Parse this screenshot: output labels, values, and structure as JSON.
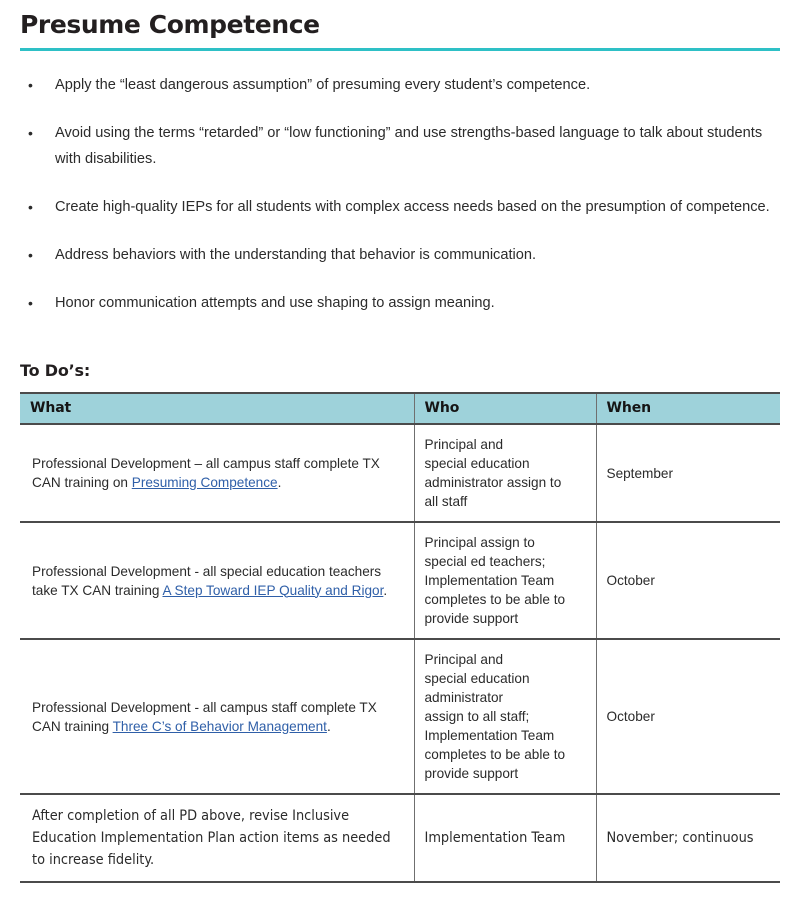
{
  "document": {
    "title": "Presume Competence",
    "accent_rule_color": "#2ec0c6",
    "table_header_color": "#9ed2da",
    "link_color": "#2f5fa8"
  },
  "bullets": [
    {
      "marker": "•",
      "text": "Apply the “least dangerous assumption” of presuming every student’s competence."
    },
    {
      "marker": "•",
      "text": "Avoid using the terms “retarded” or “low functioning” and use strengths-based language to talk about students with disabilities."
    },
    {
      "marker": "•",
      "text": "Create high-quality IEPs for all students with complex access needs based on the presumption of competence."
    },
    {
      "marker": "•",
      "text": "Address behaviors with the understanding that behavior is communication."
    },
    {
      "marker": "•",
      "text": "Honor communication attempts and use shaping to assign meaning."
    }
  ],
  "todo": {
    "heading": "To Do’s:",
    "columns": [
      "What",
      "Who",
      "When"
    ],
    "rows": [
      {
        "what_prefix": "Professional Development – all campus staff complete TX CAN training on ",
        "what_link": "Presuming Competence",
        "what_suffix": ".",
        "who_lines": [
          "Principal and",
          "special education",
          "administrator assign to",
          "all staff"
        ],
        "when": "September"
      },
      {
        "what_prefix": "Professional Development - all special education teachers take TX CAN training ",
        "what_link": "A Step Toward IEP Quality and Rigor",
        "what_suffix": ".",
        "who_lines": [
          "Principal assign to",
          "special ed teachers;",
          "Implementation Team",
          "completes to be able to",
          "provide support"
        ],
        "when": "October"
      },
      {
        "what_prefix": "Professional Development - all campus staff complete TX CAN training ",
        "what_link": "Three C’s of Behavior Management",
        "what_suffix": ".",
        "who_lines": [
          "Principal and",
          "special education",
          "administrator",
          "assign to all staff;",
          "Implementation Team",
          "completes to be able to",
          "provide support"
        ],
        "when": "October"
      },
      {
        "what_prefix": "After completion of all PD above, revise Inclusive Education Implementation Plan action items as needed to increase fidelity.",
        "what_link": "",
        "what_suffix": "",
        "who_lines": [
          "Implementation Team"
        ],
        "when": "November; continuous"
      }
    ]
  }
}
